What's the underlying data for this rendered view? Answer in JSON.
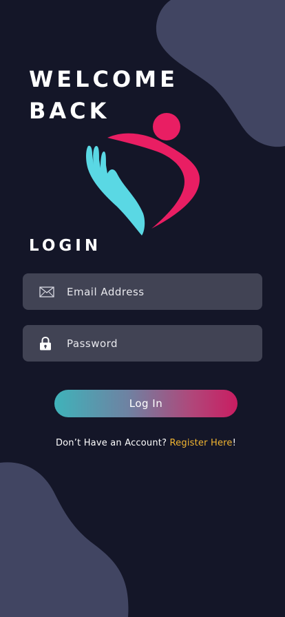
{
  "header": {
    "welcome_line1": "WELCOME",
    "welcome_line2": "BACK"
  },
  "logo": {
    "icon": "heart-hands-icon",
    "colors": {
      "hands": "#5ad8e4",
      "heart": "#e91e63"
    }
  },
  "form": {
    "title": "LOGIN",
    "email": {
      "icon": "envelope-icon",
      "placeholder": "Email Address",
      "value": ""
    },
    "password": {
      "icon": "lock-icon",
      "placeholder": "Password",
      "value": ""
    },
    "submit_label": "Log In"
  },
  "footer": {
    "prompt": "Don’t Have an Account? ",
    "register_link": "Register Here",
    "suffix": "!"
  },
  "theme": {
    "background": "#141628",
    "blob": "#414562",
    "field_background": "#414354",
    "gradient_start": "#3fb3ba",
    "gradient_end": "#c91d61",
    "link_color": "#f2b531"
  }
}
